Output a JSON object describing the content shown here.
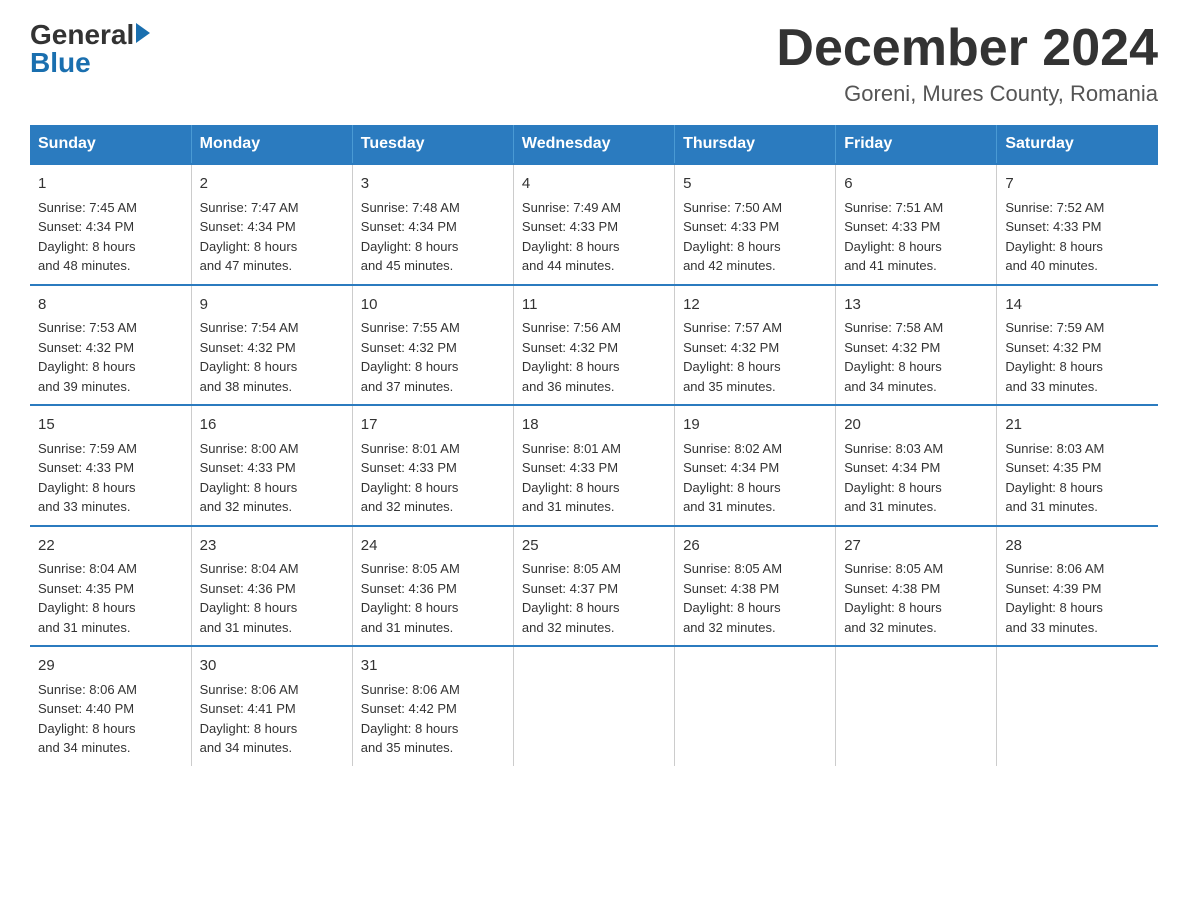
{
  "header": {
    "logo_line1": "General",
    "logo_line2": "Blue",
    "main_title": "December 2024",
    "subtitle": "Goreni, Mures County, Romania"
  },
  "columns": [
    "Sunday",
    "Monday",
    "Tuesday",
    "Wednesday",
    "Thursday",
    "Friday",
    "Saturday"
  ],
  "weeks": [
    [
      {
        "day": "1",
        "info": "Sunrise: 7:45 AM\nSunset: 4:34 PM\nDaylight: 8 hours\nand 48 minutes."
      },
      {
        "day": "2",
        "info": "Sunrise: 7:47 AM\nSunset: 4:34 PM\nDaylight: 8 hours\nand 47 minutes."
      },
      {
        "day": "3",
        "info": "Sunrise: 7:48 AM\nSunset: 4:34 PM\nDaylight: 8 hours\nand 45 minutes."
      },
      {
        "day": "4",
        "info": "Sunrise: 7:49 AM\nSunset: 4:33 PM\nDaylight: 8 hours\nand 44 minutes."
      },
      {
        "day": "5",
        "info": "Sunrise: 7:50 AM\nSunset: 4:33 PM\nDaylight: 8 hours\nand 42 minutes."
      },
      {
        "day": "6",
        "info": "Sunrise: 7:51 AM\nSunset: 4:33 PM\nDaylight: 8 hours\nand 41 minutes."
      },
      {
        "day": "7",
        "info": "Sunrise: 7:52 AM\nSunset: 4:33 PM\nDaylight: 8 hours\nand 40 minutes."
      }
    ],
    [
      {
        "day": "8",
        "info": "Sunrise: 7:53 AM\nSunset: 4:32 PM\nDaylight: 8 hours\nand 39 minutes."
      },
      {
        "day": "9",
        "info": "Sunrise: 7:54 AM\nSunset: 4:32 PM\nDaylight: 8 hours\nand 38 minutes."
      },
      {
        "day": "10",
        "info": "Sunrise: 7:55 AM\nSunset: 4:32 PM\nDaylight: 8 hours\nand 37 minutes."
      },
      {
        "day": "11",
        "info": "Sunrise: 7:56 AM\nSunset: 4:32 PM\nDaylight: 8 hours\nand 36 minutes."
      },
      {
        "day": "12",
        "info": "Sunrise: 7:57 AM\nSunset: 4:32 PM\nDaylight: 8 hours\nand 35 minutes."
      },
      {
        "day": "13",
        "info": "Sunrise: 7:58 AM\nSunset: 4:32 PM\nDaylight: 8 hours\nand 34 minutes."
      },
      {
        "day": "14",
        "info": "Sunrise: 7:59 AM\nSunset: 4:32 PM\nDaylight: 8 hours\nand 33 minutes."
      }
    ],
    [
      {
        "day": "15",
        "info": "Sunrise: 7:59 AM\nSunset: 4:33 PM\nDaylight: 8 hours\nand 33 minutes."
      },
      {
        "day": "16",
        "info": "Sunrise: 8:00 AM\nSunset: 4:33 PM\nDaylight: 8 hours\nand 32 minutes."
      },
      {
        "day": "17",
        "info": "Sunrise: 8:01 AM\nSunset: 4:33 PM\nDaylight: 8 hours\nand 32 minutes."
      },
      {
        "day": "18",
        "info": "Sunrise: 8:01 AM\nSunset: 4:33 PM\nDaylight: 8 hours\nand 31 minutes."
      },
      {
        "day": "19",
        "info": "Sunrise: 8:02 AM\nSunset: 4:34 PM\nDaylight: 8 hours\nand 31 minutes."
      },
      {
        "day": "20",
        "info": "Sunrise: 8:03 AM\nSunset: 4:34 PM\nDaylight: 8 hours\nand 31 minutes."
      },
      {
        "day": "21",
        "info": "Sunrise: 8:03 AM\nSunset: 4:35 PM\nDaylight: 8 hours\nand 31 minutes."
      }
    ],
    [
      {
        "day": "22",
        "info": "Sunrise: 8:04 AM\nSunset: 4:35 PM\nDaylight: 8 hours\nand 31 minutes."
      },
      {
        "day": "23",
        "info": "Sunrise: 8:04 AM\nSunset: 4:36 PM\nDaylight: 8 hours\nand 31 minutes."
      },
      {
        "day": "24",
        "info": "Sunrise: 8:05 AM\nSunset: 4:36 PM\nDaylight: 8 hours\nand 31 minutes."
      },
      {
        "day": "25",
        "info": "Sunrise: 8:05 AM\nSunset: 4:37 PM\nDaylight: 8 hours\nand 32 minutes."
      },
      {
        "day": "26",
        "info": "Sunrise: 8:05 AM\nSunset: 4:38 PM\nDaylight: 8 hours\nand 32 minutes."
      },
      {
        "day": "27",
        "info": "Sunrise: 8:05 AM\nSunset: 4:38 PM\nDaylight: 8 hours\nand 32 minutes."
      },
      {
        "day": "28",
        "info": "Sunrise: 8:06 AM\nSunset: 4:39 PM\nDaylight: 8 hours\nand 33 minutes."
      }
    ],
    [
      {
        "day": "29",
        "info": "Sunrise: 8:06 AM\nSunset: 4:40 PM\nDaylight: 8 hours\nand 34 minutes."
      },
      {
        "day": "30",
        "info": "Sunrise: 8:06 AM\nSunset: 4:41 PM\nDaylight: 8 hours\nand 34 minutes."
      },
      {
        "day": "31",
        "info": "Sunrise: 8:06 AM\nSunset: 4:42 PM\nDaylight: 8 hours\nand 35 minutes."
      },
      {
        "day": "",
        "info": ""
      },
      {
        "day": "",
        "info": ""
      },
      {
        "day": "",
        "info": ""
      },
      {
        "day": "",
        "info": ""
      }
    ]
  ]
}
